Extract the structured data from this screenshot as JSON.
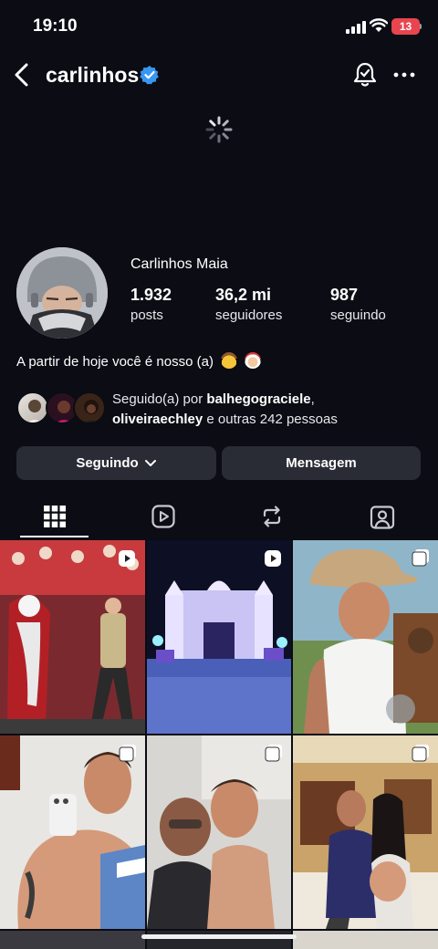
{
  "status_bar": {
    "time": "19:10",
    "battery": "13"
  },
  "header": {
    "username": "carlinhos"
  },
  "profile": {
    "full_name": "Carlinhos Maia",
    "stats": [
      {
        "value": "1.932",
        "label": "posts"
      },
      {
        "value": "36,2 mi",
        "label": "seguidores"
      },
      {
        "value": "987",
        "label": "seguindo"
      }
    ],
    "bio": "A partir de hoje você é nosso (a)",
    "followed_by": {
      "prefix": "Seguido(a) por",
      "user1": "balhegograciele",
      "user2": "oliveiraechley",
      "suffix": "e outras 242 pessoas"
    }
  },
  "actions": {
    "following": "Seguindo",
    "message": "Mensagem"
  },
  "tabs": [
    "grid-icon",
    "reels-icon",
    "reposts-icon",
    "tagged-icon"
  ],
  "colors": {
    "background": "#0b0c14",
    "button": "#2a2c35",
    "verified": "#3897f0",
    "battery": "#e8454f"
  }
}
